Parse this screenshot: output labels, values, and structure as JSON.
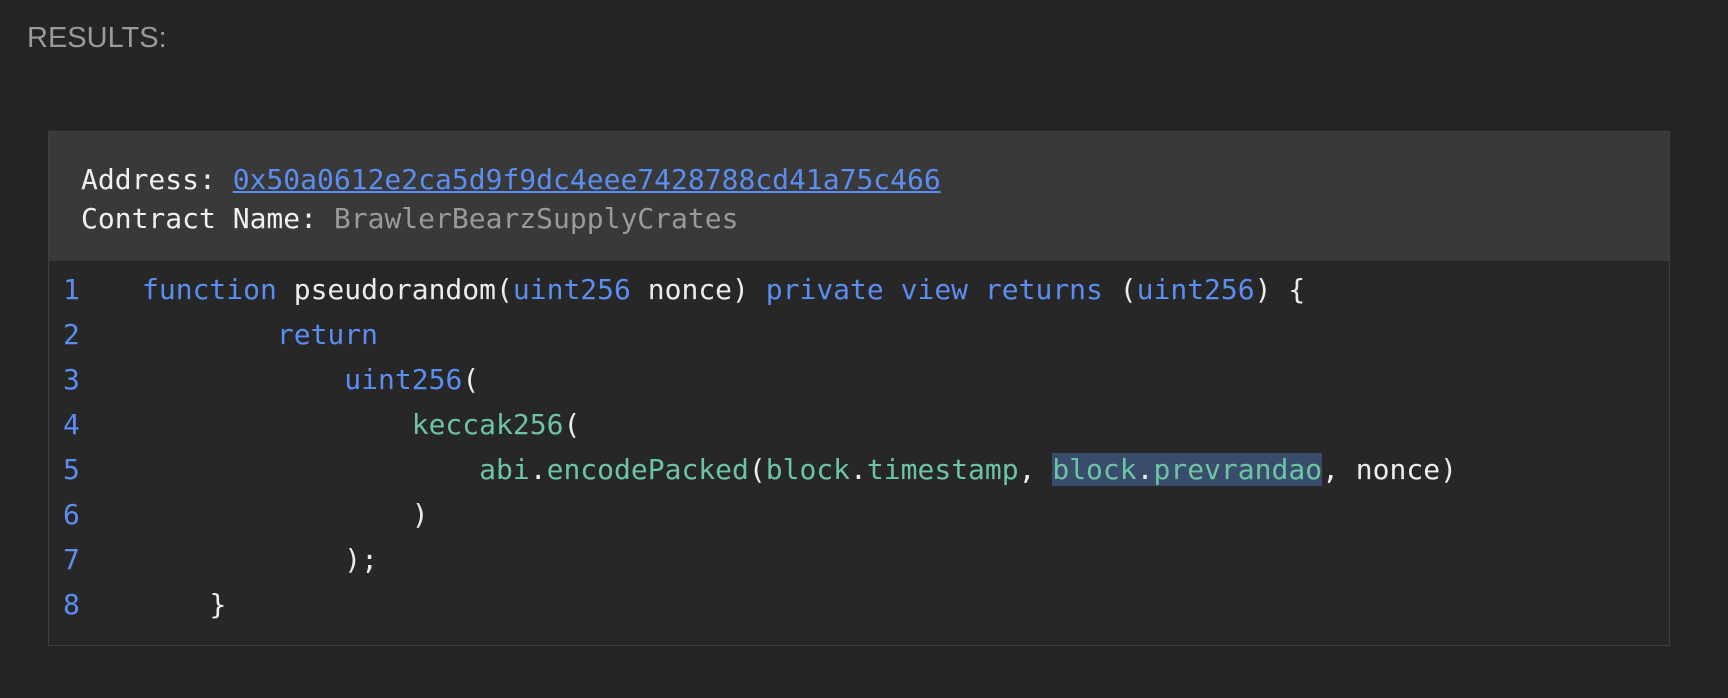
{
  "results_label": "RESULTS:",
  "header": {
    "address_label": "Address: ",
    "address_value": "0x50a0612e2ca5d9f9dc4eee7428788cd41a75c466",
    "contract_label": "Contract Name: ",
    "contract_value": "BrawlerBearzSupplyCrates"
  },
  "code": {
    "line_numbers": [
      "1",
      "2",
      "3",
      "4",
      "5",
      "6",
      "7",
      "8"
    ],
    "l1": {
      "indent": "",
      "t1": "function",
      "t2": " pseudorandom(",
      "t3": "uint256",
      "t4": " nonce) ",
      "t5": "private view returns",
      "t6": " (",
      "t7": "uint256",
      "t8": ") {"
    },
    "l2": {
      "indent": "        ",
      "t1": "return"
    },
    "l3": {
      "indent": "            ",
      "t1": "uint256",
      "t2": "("
    },
    "l4": {
      "indent": "                ",
      "t1": "keccak256",
      "t2": "("
    },
    "l5": {
      "indent": "                    ",
      "t1": "abi",
      "t2": ".",
      "t3": "encodePacked",
      "t4": "(",
      "t5": "block",
      "t6": ".",
      "t7": "timestamp",
      "t8": ", ",
      "t9": "block",
      "t10": ".",
      "t11": "prevrandao",
      "t12": ", nonce)"
    },
    "l6": {
      "indent": "                ",
      "t1": ")"
    },
    "l7": {
      "indent": "            ",
      "t1": ");"
    },
    "l8": {
      "indent": "    ",
      "t1": "}"
    }
  }
}
